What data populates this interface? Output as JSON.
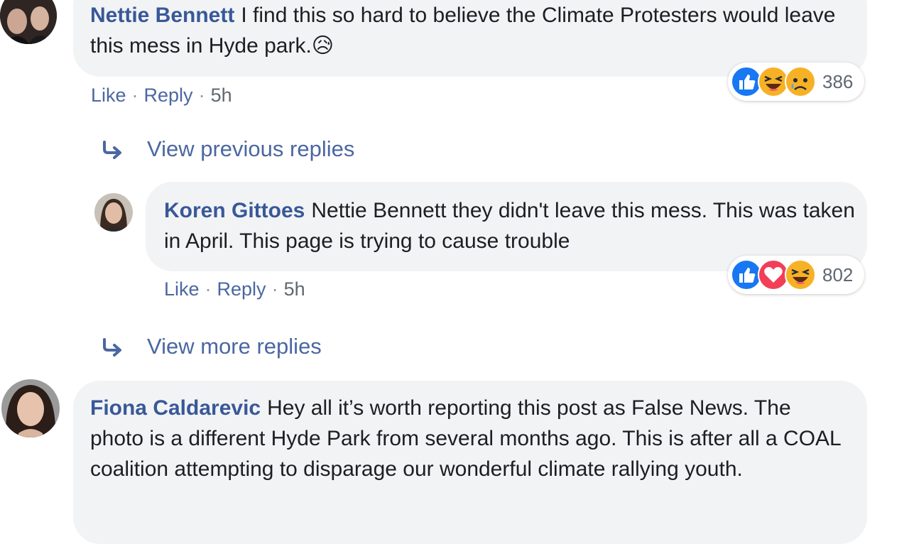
{
  "comments": [
    {
      "author": "Nettie Bennett",
      "text": "I find this so hard to believe the Climate Protesters would leave this mess in Hyde park.",
      "emoji": "😥",
      "reaction_icons": [
        "like-icon",
        "haha-icon",
        "sad-icon"
      ],
      "reaction_count": "386",
      "like_label": "Like",
      "reply_label": "Reply",
      "time": "5h"
    },
    {
      "author": "Koren Gittoes",
      "text": "Nettie Bennett they didn't leave this mess. This was taken in April. This page is trying to cause trouble",
      "reaction_icons": [
        "like-icon",
        "love-icon",
        "haha-icon"
      ],
      "reaction_count": "802",
      "like_label": "Like",
      "reply_label": "Reply",
      "time": "5h"
    },
    {
      "author": "Fiona Caldarevic",
      "text": "Hey all it’s worth reporting this post as False News. The photo is a different Hyde Park from several months ago. This is after all a COAL coalition attempting to disparage our wonderful climate rallying youth."
    }
  ],
  "view_previous_replies": "View previous replies",
  "view_more_replies": "View more replies",
  "separator": "·",
  "colors": {
    "link": "#385898",
    "bubble": "#f2f3f5",
    "like_blue": "#1877f2",
    "love_red": "#f33e58",
    "emoji_yellow": "#f7b125"
  }
}
